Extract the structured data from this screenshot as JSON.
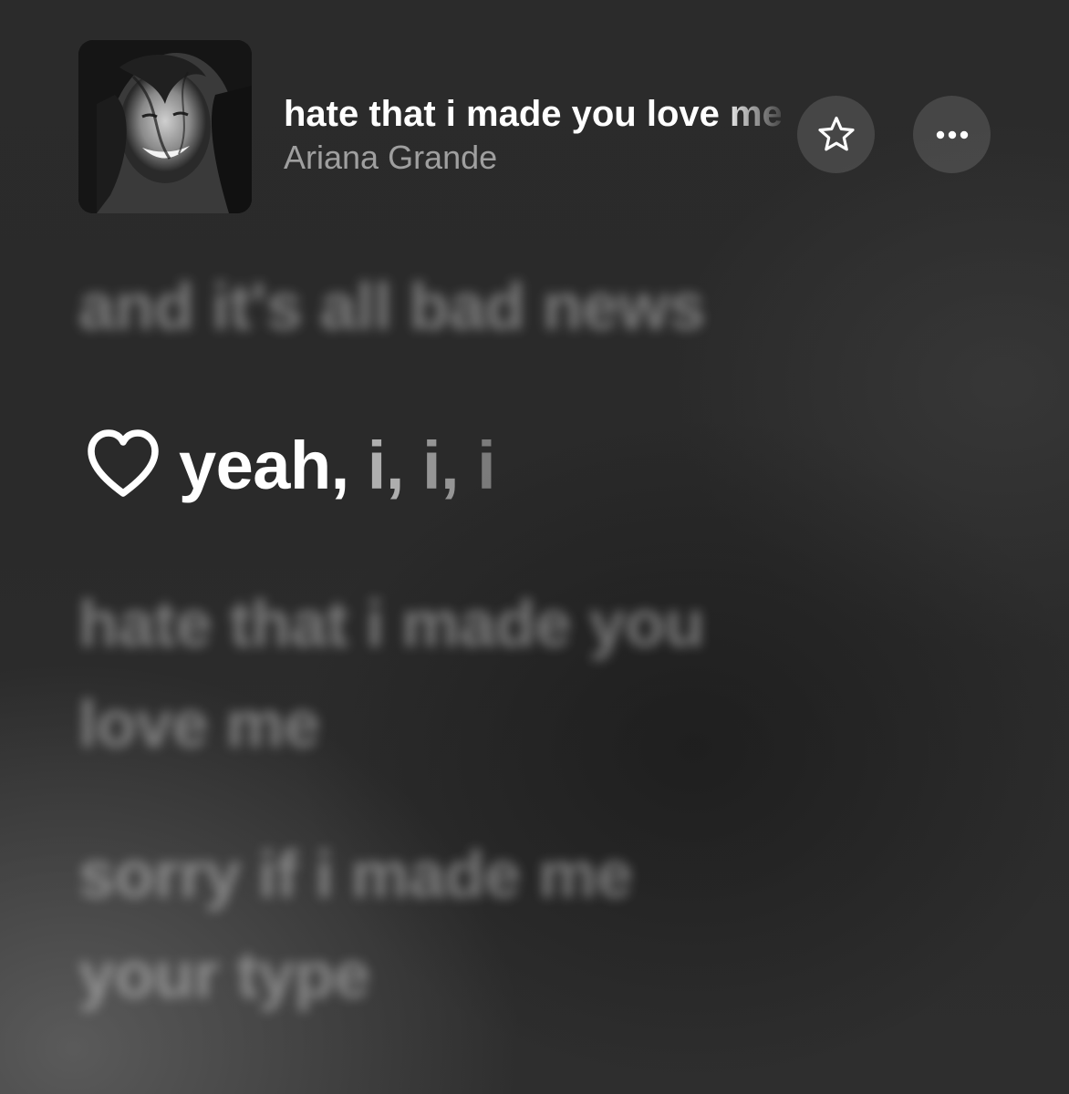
{
  "now_playing": {
    "title": "hate that i made you love me",
    "artist": "Ariana Grande"
  },
  "lyrics": {
    "previous": "and it's all bad news",
    "current_sung": "yeah,",
    "current_unsung": [
      " i,",
      " i,",
      " i"
    ],
    "next": "hate that i made you\nlove me",
    "next2": "sorry if i made me\nyour type"
  },
  "icons": {
    "artwork": "album-artwork",
    "favorite": "star-icon",
    "more": "ellipsis-icon",
    "lyric_marker": "heart-icon"
  },
  "colors": {
    "background": "#2a2a2a",
    "text": "#ffffff"
  }
}
